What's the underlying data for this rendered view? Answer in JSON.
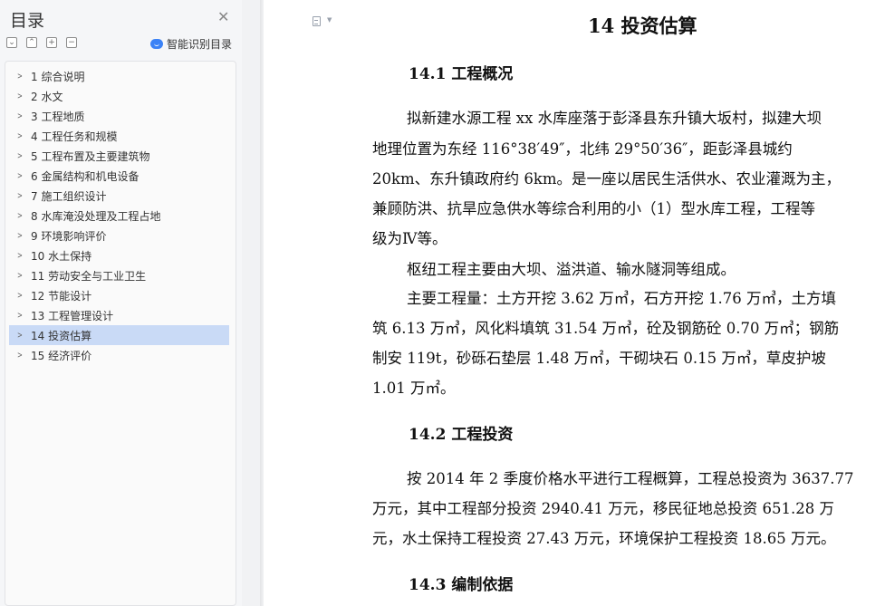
{
  "sidebar": {
    "title": "目录",
    "close_icon": "close-icon",
    "tools": [
      {
        "name": "collapse-all-icon",
        "glyph": "⌄"
      },
      {
        "name": "expand-all-icon",
        "glyph": "⌃"
      },
      {
        "name": "add-heading-icon",
        "glyph": "+"
      },
      {
        "name": "remove-heading-icon",
        "glyph": "−"
      }
    ],
    "smart_label": "智能识别目录",
    "items": [
      {
        "label": "1 综合说明",
        "active": false
      },
      {
        "label": "2 水文",
        "active": false
      },
      {
        "label": "3 工程地质",
        "active": false
      },
      {
        "label": "4 工程任务和规模",
        "active": false
      },
      {
        "label": "5 工程布置及主要建筑物",
        "active": false
      },
      {
        "label": "6 金属结构和机电设备",
        "active": false
      },
      {
        "label": "7 施工组织设计",
        "active": false
      },
      {
        "label": "8 水库淹没处理及工程占地",
        "active": false
      },
      {
        "label": "9 环境影响评价",
        "active": false
      },
      {
        "label": "10 水土保持",
        "active": false
      },
      {
        "label": "11 劳动安全与工业卫生",
        "active": false
      },
      {
        "label": "12 节能设计",
        "active": false
      },
      {
        "label": "13 工程管理设计",
        "active": false
      },
      {
        "label": "14 投资估算",
        "active": true
      },
      {
        "label": "15 经济评价",
        "active": false
      }
    ],
    "active_color": "#c9daf6"
  },
  "document": {
    "title": "14 投资估算",
    "s1_heading": "14.1 工程概况",
    "p1": [
      "拟新建水源工程 xx 水库座落于彭泽县东升镇大坂村，拟建大坝",
      "地理位置为东经 116°38′49″，北纬 29°50′36″，距彭泽县城约",
      "20km、东升镇政府约 6km。是一座以居民生活供水、农业灌溉为主，",
      "兼顾防洪、抗旱应急供水等综合利用的小（1）型水库工程，工程等",
      "级为Ⅳ等。"
    ],
    "p2": "枢纽工程主要由大坝、溢洪道、输水隧洞等组成。",
    "p3": [
      "主要工程量：土方开挖 3.62 万㎥，石方开挖 1.76 万㎥，土方填",
      "筑 6.13 万㎥，风化料填筑 31.54 万㎥，砼及钢筋砼 0.70 万㎥；钢筋",
      "制安 119t，砂砾石垫层 1.48 万㎡，干砌块石 0.15 万㎥，草皮护坡",
      "1.01 万㎡。"
    ],
    "s2_heading": "14.2 工程投资",
    "p4": [
      "按 2014 年 2 季度价格水平进行工程概算，工程总投资为 3637.77",
      "万元，其中工程部分投资 2940.41 万元，移民征地总投资 651.28 万",
      "元，水土保持工程投资 27.43 万元，环境保护工程投资 18.65 万元。"
    ],
    "s3_heading": "14.3 编制依据"
  }
}
